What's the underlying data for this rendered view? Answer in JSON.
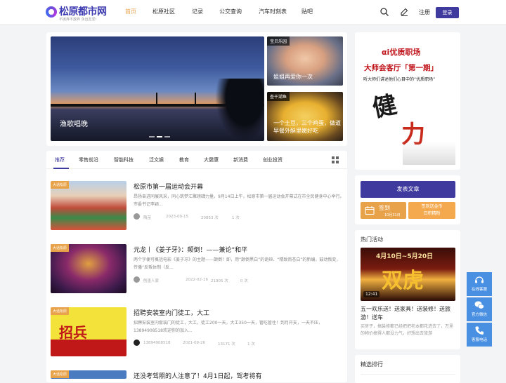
{
  "header": {
    "logo_text": "松原都市网",
    "logo_sub": "不抛弃不放弃 永远互爱!",
    "nav": [
      "首页",
      "松原社区",
      "记录",
      "公交查询",
      "汽车时刻表",
      "贴吧"
    ],
    "register": "注册",
    "login": "登录"
  },
  "slider": {
    "caption": "渔歌唱晚",
    "side": [
      {
        "tag": "宝贝乐园",
        "title": "姐姐再爱你一次"
      },
      {
        "tag": "查干湖鱼",
        "title": "一个土豆，三个鸡蛋，做道早餐外酥里嫩好吃"
      }
    ]
  },
  "tabs": [
    "推荐",
    "零售前沿",
    "智能科技",
    "泛文娱",
    "教育",
    "大健康",
    "新消费",
    "创业投资"
  ],
  "articles": [
    {
      "tag": "大话松原",
      "title": "松原市第一届运动会开幕",
      "summary": "昂扬奋进同展风采，同心筑梦汇聚磅礴力量。9月14日上午，松原市第一届运动会开幕式在市全民健身中心举行。市委书记李颖...",
      "author": "隋苗",
      "date": "2023-09-15",
      "views": "20853 次",
      "comments": "1 次"
    },
    {
      "tag": "大话松原",
      "title": "元龙丨《姜子牙》：颠倒！——兼论“和平",
      "summary": "两个字便可概括电影《姜子牙》的主题——颠倒！即，用“颠倒黑白”的诡辩、“精致而苍白”的新编，鼓动叛变，传播“反叛体制（反...",
      "author": "刨墨人家",
      "date": "2022-02-16",
      "views": "21905 次",
      "comments": "0 次"
    },
    {
      "tag": "大话松原",
      "title": "招聘安装室内门徒工，大工",
      "summary": "招聘安装室内套装门的徒工，大工，徒工200一天，大工350一天，管吃管住！到月开支，一天不压，13894908518欢迎你的加入...",
      "author": "13894908518",
      "date": "2021-09-26",
      "views": "13171 次",
      "comments": "1 次"
    },
    {
      "tag": "大话松原",
      "title": "还没考驾照的人注意了！4月1日起，驾考将有"
    }
  ],
  "sidebar": {
    "ad": {
      "brand": "αi优质职场",
      "title": "大师会客厅「第一期」",
      "sub": "听大师们讲述他们心目中的“优质职场”",
      "glyph1": "健",
      "glyph2": "力"
    },
    "publish": "发表文章",
    "sign": {
      "label": "签到",
      "date": "10月31日"
    },
    "sign_right": [
      "签到送金币",
      "日积精粉"
    ],
    "hot_title": "热门活动",
    "hot": {
      "duration": "12:41",
      "banner": "4月10日~5月20日",
      "title": "五一欢乐送！送家具！送装修！送旅游！送车",
      "summary": "买房子，搞装修都已经把把老本都花进去了，万里的物价搞得人都没力气，好想出去旅游"
    },
    "rank_title": "精选排行"
  },
  "float": [
    "在线客服",
    "官方微信",
    "客服电话"
  ],
  "colors": {
    "brand": "#3f3a9e",
    "accent": "#e8a24a",
    "float": "#4a90e2"
  }
}
